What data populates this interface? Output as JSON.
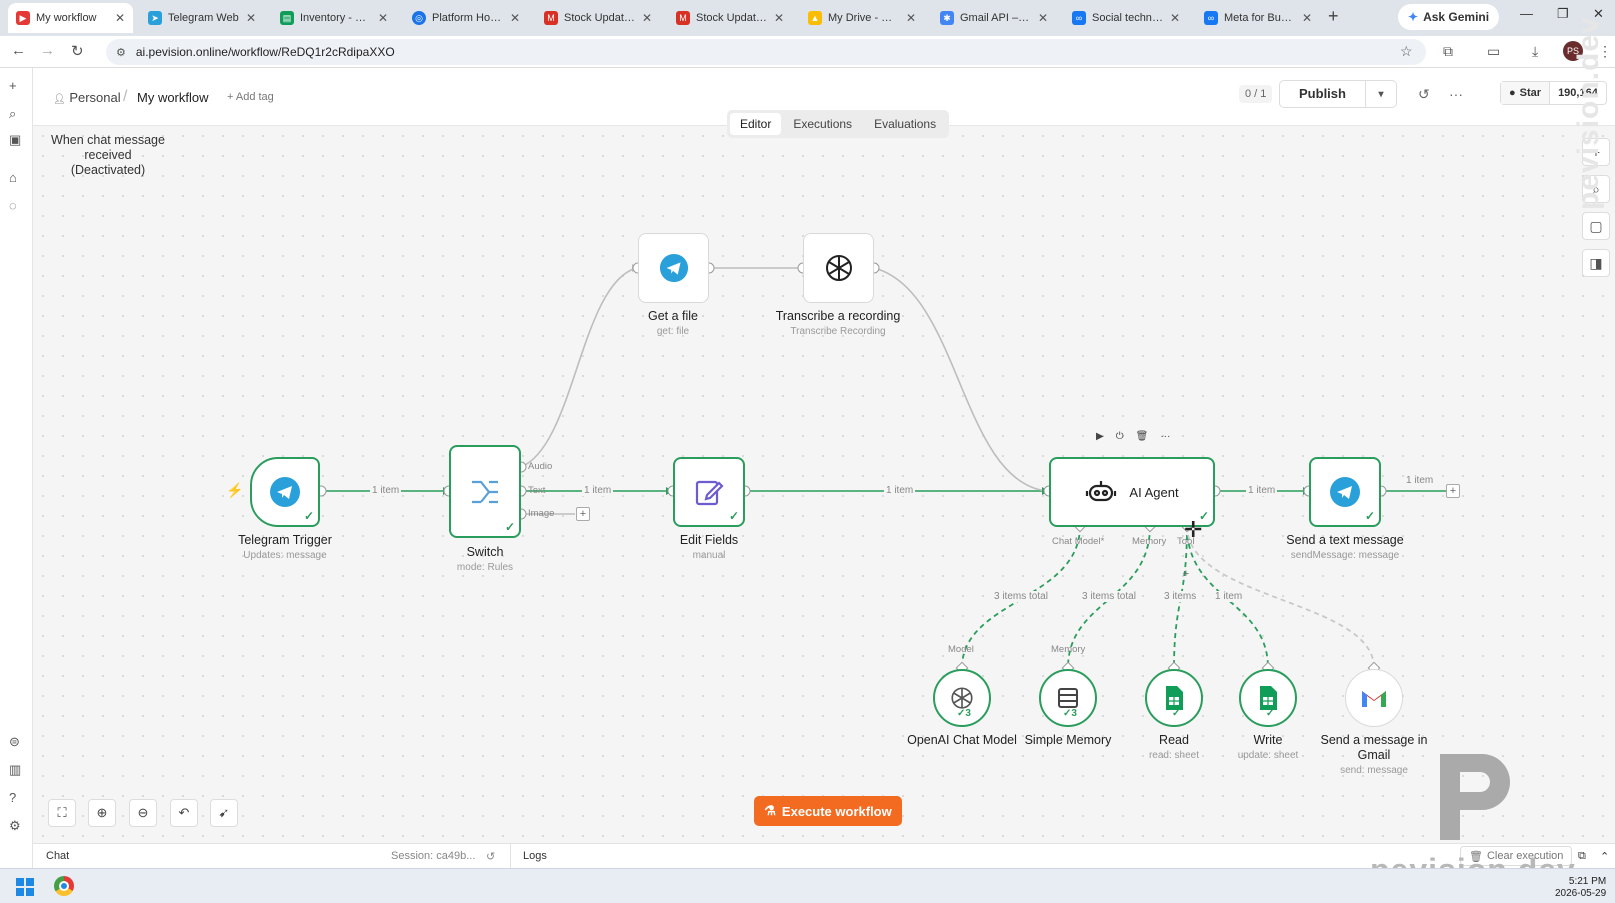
{
  "browser": {
    "tabs": [
      {
        "label": "My workflow",
        "active": true,
        "color": "#e53935"
      },
      {
        "label": "Telegram Web",
        "color": "#29a0da"
      },
      {
        "label": "Inventory - Goo",
        "color": "#0f9d58"
      },
      {
        "label": "Platform Home",
        "color": "#1a73e8"
      },
      {
        "label": "Stock Update -",
        "color": "#d93025"
      },
      {
        "label": "Stock Update -",
        "color": "#d93025"
      },
      {
        "label": "My Drive - Goo",
        "color": "#fbbc04"
      },
      {
        "label": "Gmail API – Ma",
        "color": "#4285f4"
      },
      {
        "label": "Social technolo",
        "color": "#1877f2"
      },
      {
        "label": "Meta for Busine",
        "color": "#1877f2"
      }
    ],
    "ask_gemini": "Ask Gemini",
    "url": "ai.pevision.online/workflow/ReDQ1r2cRdipaXXO",
    "profile_initials": "PS"
  },
  "header": {
    "breadcrumb_personal": "Personal",
    "breadcrumb_workflow": "My workflow",
    "add_tag": "+ Add tag",
    "counter": "0 / 1",
    "publish": "Publish",
    "star": "Star",
    "star_count": "190,164"
  },
  "mode_tabs": [
    "Editor",
    "Executions",
    "Evaluations"
  ],
  "sticky_note": "When chat message received (Deactivated)",
  "nodes": {
    "telegram_trigger": {
      "title": "Telegram Trigger",
      "sub": "Updates: message"
    },
    "switch": {
      "title": "Switch",
      "sub": "mode: Rules",
      "outputs": [
        "Audio",
        "Text",
        "Image"
      ]
    },
    "get_file": {
      "title": "Get a file",
      "sub": "get: file"
    },
    "transcribe": {
      "title": "Transcribe a recording",
      "sub": "Transcribe Recording"
    },
    "edit_fields": {
      "title": "Edit Fields",
      "sub": "manual"
    },
    "ai_agent": {
      "title": "AI Agent",
      "ports": [
        "Chat Model*",
        "Memory",
        "Tool"
      ]
    },
    "send_text": {
      "title": "Send a text message",
      "sub": "sendMessage: message"
    },
    "openai_model": {
      "title": "OpenAI Chat Model",
      "count": "3",
      "port": "Model"
    },
    "simple_memory": {
      "title": "Simple Memory",
      "count": "3",
      "port": "Memory"
    },
    "read": {
      "title": "Read",
      "sub": "read: sheet"
    },
    "write": {
      "title": "Write",
      "sub": "update: sheet"
    },
    "gmail": {
      "title": "Send a message in Gmail",
      "sub": "send: message"
    }
  },
  "edge_labels": {
    "trigger_switch": "1 item",
    "switch_edit": "1 item",
    "edit_agent": "1 item",
    "agent_send": "1 item",
    "send_out": "1 item",
    "model": "3 items total",
    "memory": "3 items total",
    "read": "3 items",
    "write": "1 item"
  },
  "execute_button": "Execute workflow",
  "logbar": {
    "chat": "Chat",
    "session": "Session: ca49b...",
    "logs": "Logs",
    "clear": "Clear execution"
  },
  "watermark": "pevision.dev",
  "taskbar": {
    "time": "5:21 PM",
    "date": "2026-05-29"
  },
  "colors": {
    "success": "#2a9d5c",
    "accent": "#f26b21",
    "telegram": "#29a0da"
  }
}
